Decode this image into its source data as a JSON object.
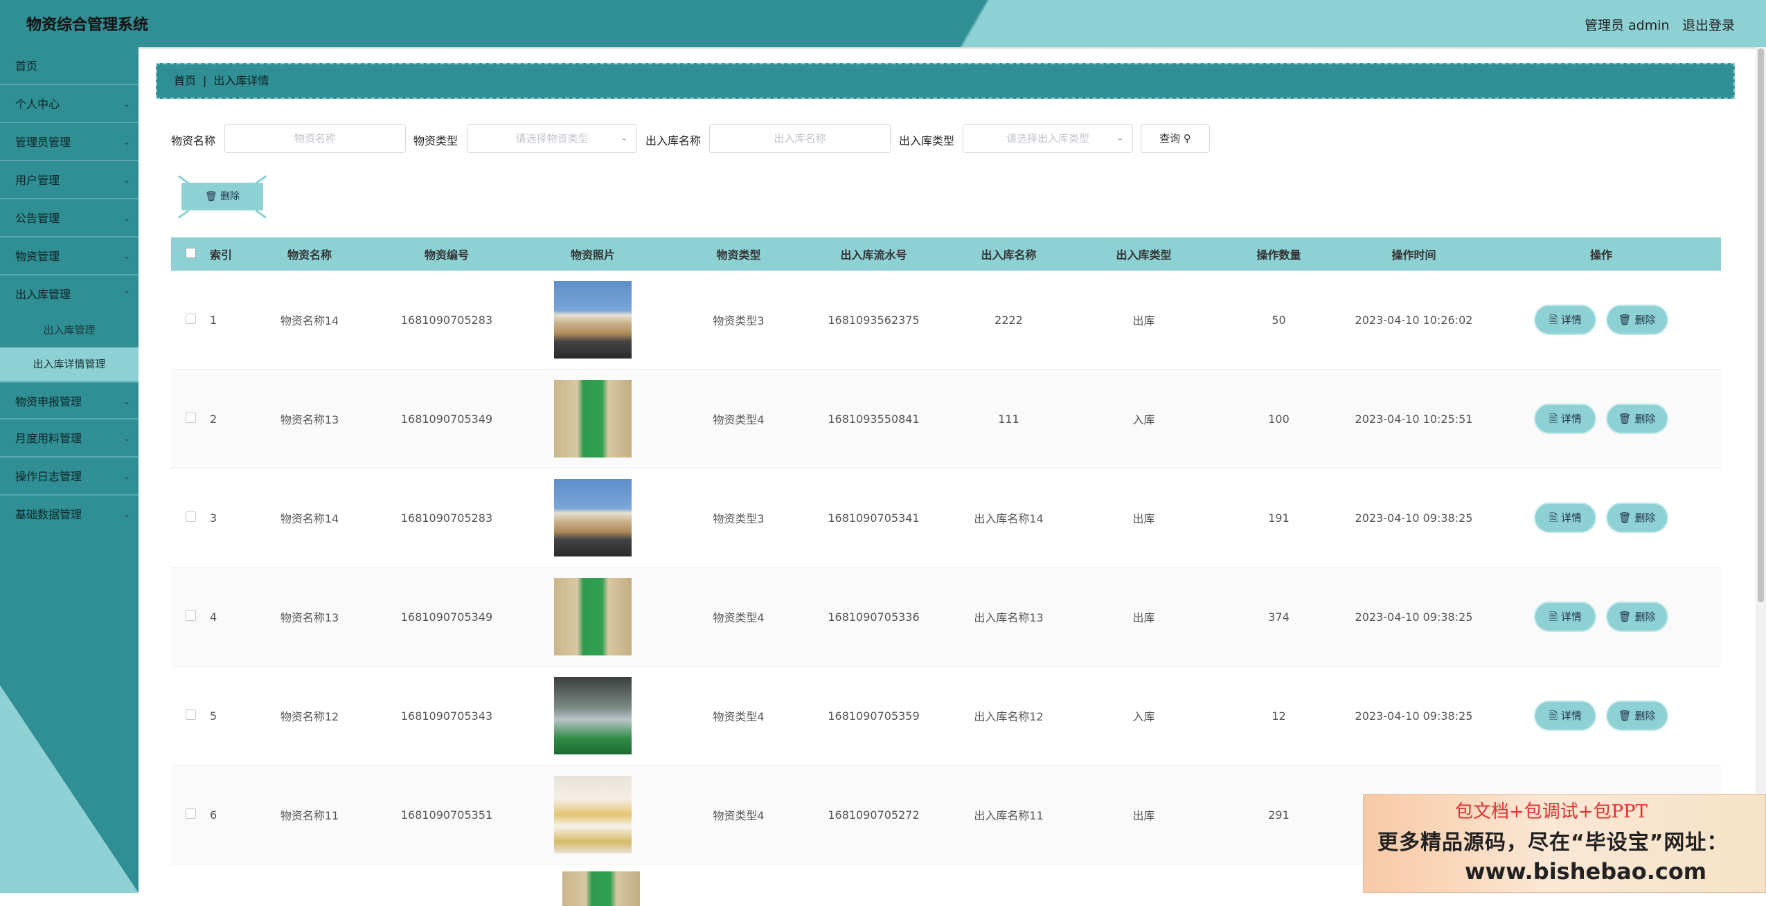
{
  "header": {
    "title": "物资综合管理系统",
    "admin": "管理员 admin",
    "logout": "退出登录"
  },
  "sidebar": {
    "items": [
      {
        "label": "首页"
      },
      {
        "label": "个人中心"
      },
      {
        "label": "管理员管理"
      },
      {
        "label": "用户管理"
      },
      {
        "label": "公告管理"
      },
      {
        "label": "物资管理"
      },
      {
        "label": "出入库管理"
      },
      {
        "label": "物资申报管理"
      },
      {
        "label": "月度用料管理"
      },
      {
        "label": "操作日志管理"
      },
      {
        "label": "基础数据管理"
      }
    ],
    "subitems": [
      "出入库管理",
      "出入库详情管理"
    ]
  },
  "breadcrumb": {
    "home": "首页",
    "current": "出入库详情"
  },
  "filters": {
    "name_label": "物资名称",
    "name_placeholder": "物资名称",
    "type_label": "物资类型",
    "type_placeholder": "请选择物资类型",
    "io_name_label": "出入库名称",
    "io_name_placeholder": "出入库名称",
    "io_type_label": "出入库类型",
    "io_type_placeholder": "请选择出入库类型",
    "query": "查询"
  },
  "batch_delete": "删除",
  "table": {
    "headers": [
      "索引",
      "物资名称",
      "物资编号",
      "物资照片",
      "物资类型",
      "出入库流水号",
      "出入库名称",
      "出入库类型",
      "操作数量",
      "操作时间",
      "操作"
    ],
    "rows": [
      {
        "idx": "1",
        "name": "物资名称14",
        "code": "1681090705283",
        "photo": "plane",
        "type": "物资类型3",
        "serial": "1681093562375",
        "io_name": "2222",
        "io_type": "出库",
        "qty": "50",
        "time": "2023-04-10 10:26:02"
      },
      {
        "idx": "2",
        "name": "物资名称13",
        "code": "1681090705349",
        "photo": "aisle",
        "type": "物资类型4",
        "serial": "1681093550841",
        "io_name": "111",
        "io_type": "入库",
        "qty": "100",
        "time": "2023-04-10 10:25:51"
      },
      {
        "idx": "3",
        "name": "物资名称14",
        "code": "1681090705283",
        "photo": "plane",
        "type": "物资类型3",
        "serial": "1681090705341",
        "io_name": "出入库名称14",
        "io_type": "出库",
        "qty": "191",
        "time": "2023-04-10 09:38:25"
      },
      {
        "idx": "4",
        "name": "物资名称13",
        "code": "1681090705349",
        "photo": "aisle",
        "type": "物资类型4",
        "serial": "1681090705336",
        "io_name": "出入库名称13",
        "io_type": "出库",
        "qty": "374",
        "time": "2023-04-10 09:38:25"
      },
      {
        "idx": "5",
        "name": "物资名称12",
        "code": "1681090705343",
        "photo": "factory",
        "type": "物资类型4",
        "serial": "1681090705359",
        "io_name": "出入库名称12",
        "io_type": "入库",
        "qty": "12",
        "time": "2023-04-10 09:38:25"
      },
      {
        "idx": "6",
        "name": "物资名称11",
        "code": "1681090705351",
        "photo": "shelf",
        "type": "物资类型4",
        "serial": "1681090705272",
        "io_name": "出入库名称11",
        "io_type": "出库",
        "qty": "291",
        "time": ""
      }
    ],
    "detail_label": "详情",
    "delete_label": "删除"
  },
  "ad": {
    "line1": "包文档+包调试+包PPT",
    "line2": "更多精品源码，尽在“毕设宝”网址：",
    "line3": "www.bishebao.com"
  }
}
